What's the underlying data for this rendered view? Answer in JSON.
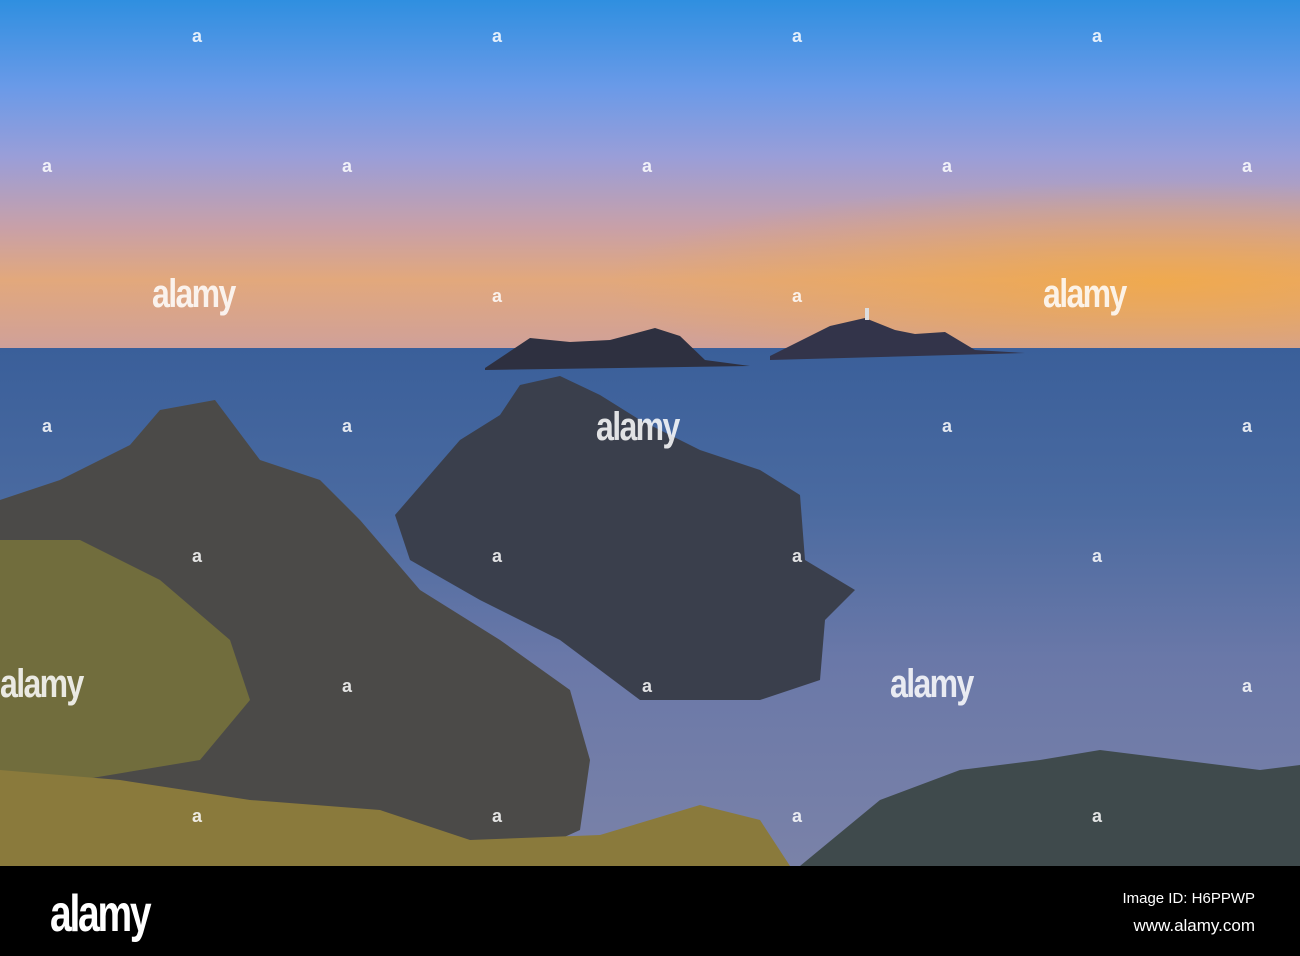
{
  "watermark": {
    "text": "alamy",
    "mark": "a"
  },
  "footer": {
    "logo": "alamy",
    "image_id": "Image ID: H6PPWP",
    "url": "www.alamy.com"
  }
}
